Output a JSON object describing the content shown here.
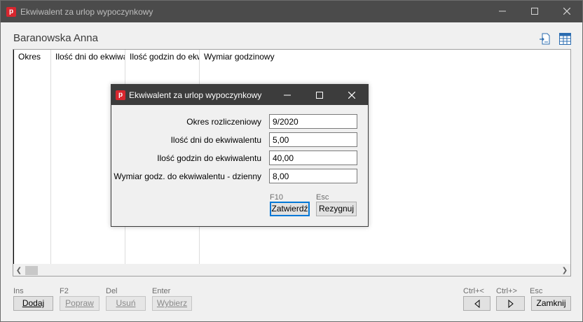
{
  "window": {
    "title": "Ekwiwalent za urlop wypoczynkowy",
    "app_icon_letter": "p"
  },
  "person": "Baranowska Anna",
  "grid": {
    "columns": [
      "Okres",
      "Ilość dni do ekwiwalentu",
      "Ilość godzin do ekwiwalentu",
      "Wymiar godzinowy"
    ]
  },
  "dialog": {
    "title": "Ekwiwalent za urlop wypoczynkowy",
    "app_icon_letter": "p",
    "fields": [
      {
        "label": "Okres rozliczeniowy",
        "value": "9/2020"
      },
      {
        "label": "Ilość dni do ekwiwalentu",
        "value": "5,00"
      },
      {
        "label": "Ilość godzin do ekwiwalentu",
        "value": "40,00"
      },
      {
        "label": "Wymiar godz. do ekwiwalentu - dzienny",
        "value": "8,00"
      }
    ],
    "confirm": {
      "key": "F10",
      "label": "Zatwierdź"
    },
    "cancel": {
      "key": "Esc",
      "label": "Rezygnuj"
    }
  },
  "footer": {
    "add": {
      "key": "Ins",
      "label": "Dodaj"
    },
    "edit": {
      "key": "F2",
      "label": "Popraw"
    },
    "delete": {
      "key": "Del",
      "label": "Usuń"
    },
    "select": {
      "key": "Enter",
      "label": "Wybierz"
    },
    "prev": {
      "key": "Ctrl+<"
    },
    "next": {
      "key": "Ctrl+>"
    },
    "close": {
      "key": "Esc",
      "label": "Zamknij"
    }
  },
  "colors": {
    "titlebar": "#4b4b4b",
    "dialog_titlebar": "#3c3c3c",
    "brand": "#d7262e",
    "focus": "#0078d7"
  }
}
